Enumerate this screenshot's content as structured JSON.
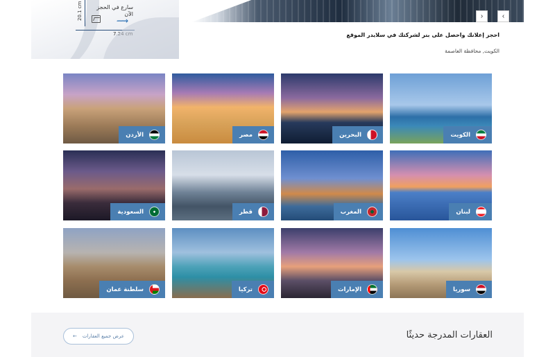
{
  "ad": {
    "height_dim": "20.1 cm",
    "width_dim": "7.24 cm",
    "availability": "سارع في الحجز الآن",
    "title": "احجز إعلانك واحصل على بنر لشركتك في سلايدر الموقع",
    "location": "الكويت, محافظة العاصمة",
    "prev_label": "‹",
    "next_label": "›"
  },
  "countries": [
    {
      "name": "الكويت",
      "scene": "kuwait",
      "flag": "kw"
    },
    {
      "name": "البحرين",
      "scene": "bahrain",
      "flag": "bh"
    },
    {
      "name": "مصر",
      "scene": "egypt",
      "flag": "eg"
    },
    {
      "name": "الأردن",
      "scene": "jordan",
      "flag": "jo"
    },
    {
      "name": "لبنان",
      "scene": "lebanon",
      "flag": "lb"
    },
    {
      "name": "المغرب",
      "scene": "morocco",
      "flag": "ma"
    },
    {
      "name": "قطر",
      "scene": "qatar",
      "flag": "qa"
    },
    {
      "name": "السعودية",
      "scene": "saudi",
      "flag": "sa"
    },
    {
      "name": "سوريا",
      "scene": "syria",
      "flag": "sy"
    },
    {
      "name": "الإمارات",
      "scene": "uae",
      "flag": "ae"
    },
    {
      "name": "تركيا",
      "scene": "turkey",
      "flag": "tr"
    },
    {
      "name": "سلطنة عمان",
      "scene": "oman",
      "flag": "om"
    }
  ],
  "recent": {
    "title": "العقارات المدرجة حديثًا",
    "view_all": "عرض جميع العقارات",
    "arrow": "←"
  },
  "colors": {
    "label_bg": "#4a7fb2",
    "accent": "#2a6fb3"
  }
}
